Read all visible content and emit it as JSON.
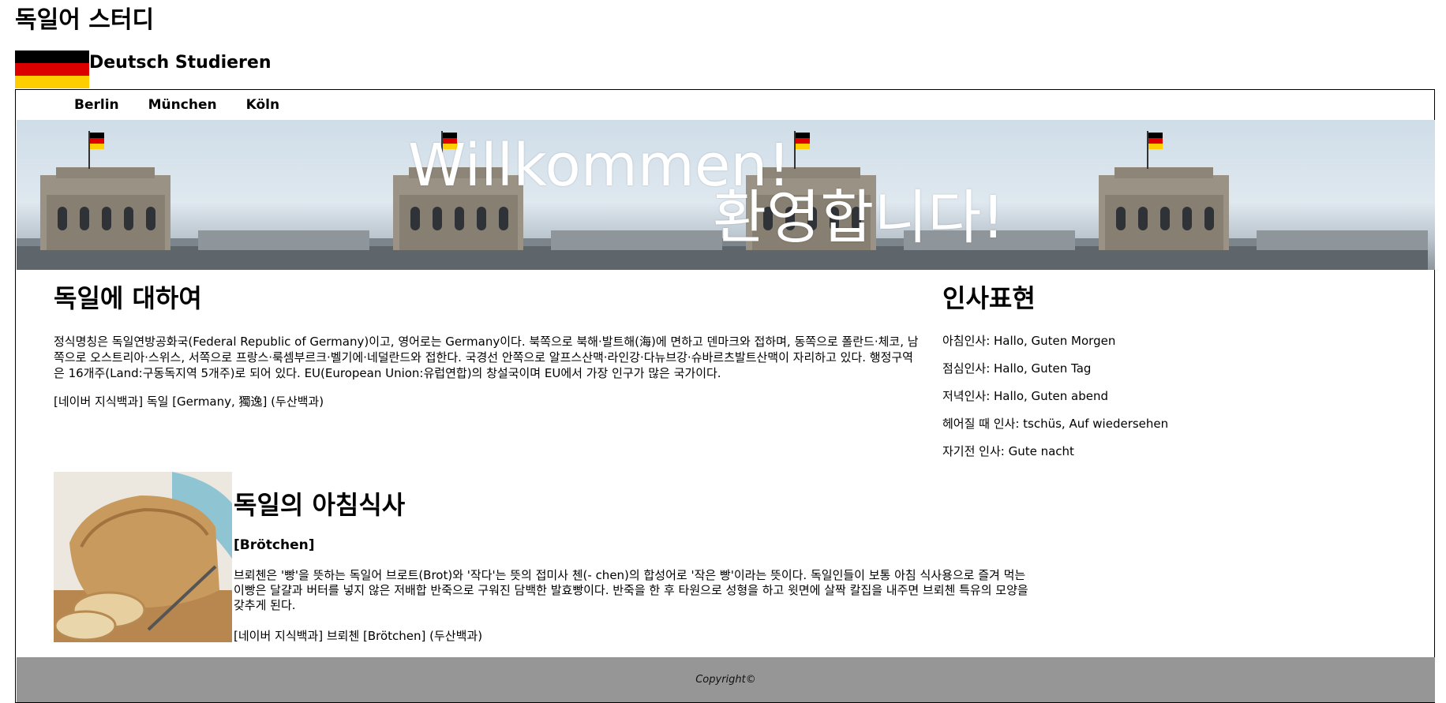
{
  "header": {
    "site_title": "독일어 스터디",
    "brand_name": "Deutsch Studieren",
    "flag_colors": [
      "#000000",
      "#dd0000",
      "#ffce00"
    ]
  },
  "nav": {
    "links": [
      "Berlin",
      "München",
      "Köln"
    ]
  },
  "hero": {
    "line1": "Willkommen!",
    "line2": "환영합니다!"
  },
  "about": {
    "title": "독일에 대하여",
    "text": "정식명칭은 독일연방공화국(Federal Republic of Germany)이고, 영어로는 Germany이다. 북쪽으로 북해·발트해(海)에 면하고 덴마크와 접하며, 동쪽으로 폴란드·체코, 남쪽으로 오스트리아·스위스, 서쪽으로 프랑스·룩셈부르크·벨기에·네덜란드와 접한다. 국경선 안쪽으로 알프스산맥·라인강·다뉴브강·슈바르츠발트산맥이 자리하고 있다. 행정구역은 16개주(Land:구동독지역 5개주)로 되어 있다. EU(European Union:유럽연합)의 창설국이며 EU에서 가장 인구가 많은 국가이다.",
    "source": "[네이버 지식백과] 독일 [Germany, 獨逸] (두산백과)"
  },
  "greetings": {
    "title": "인사표현",
    "items": [
      "아침인사: Hallo, Guten Morgen",
      "점심인사: Hallo, Guten Tag",
      "저녁인사: Hallo, Guten abend",
      "헤어질 때 인사: tschüs, Auf wiedersehen",
      "자기전 인사: Gute nacht"
    ]
  },
  "breakfast": {
    "title": "독일의 아침식사",
    "subtitle": "[Brötchen]",
    "text": "브뢰첸은 '빵'을 뜻하는 독일어 브로트(Brot)와 '작다'는 뜻의 접미사 첸(- chen)의 합성어로 '작은 빵'이라는 뜻이다. 독일인들이 보통 아침 식사용으로 즐겨 먹는 이빵은 달걀과 버터를 넣지 않은 저배합 반죽으로 구워진 담백한 발효빵이다. 반죽을 한 후 타원으로 성형을 하고 윗면에 살짝 칼집을 내주면 브뢰첸 특유의 모양을 갖추게 된다.",
    "source": "[네이버 지식백과] 브뢰첸 [Brötchen] (두산백과)"
  },
  "footer": {
    "copyright": "Copyright©",
    "background": "#969696"
  }
}
